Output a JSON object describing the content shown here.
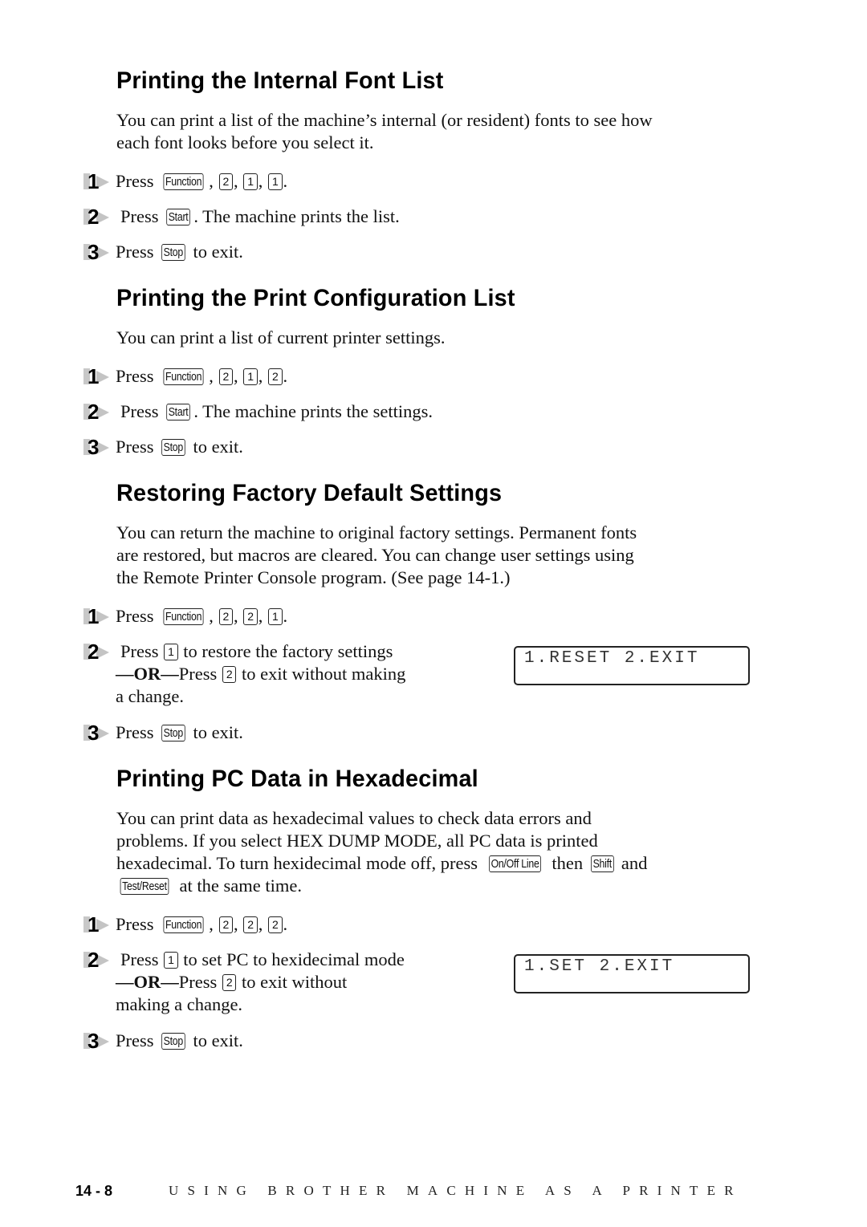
{
  "sections": [
    {
      "heading": "Printing the Internal Font List",
      "intro": [
        "You can print a list of the machine’s internal (or resident) fonts to see how",
        "each font looks before you select it."
      ],
      "steps": [
        {
          "num": "1",
          "before": "Press",
          "keys": [
            "Function",
            "2",
            "1",
            "1"
          ],
          "after": "."
        },
        {
          "num": "2",
          "before": "Press",
          "keys": [
            "Start"
          ],
          "after": ". The machine prints the list."
        },
        {
          "num": "3",
          "before": "Press",
          "keys": [
            "Stop"
          ],
          "after": " to exit."
        }
      ]
    },
    {
      "heading": "Printing the Print Configuration List",
      "intro": [
        "You can print a list of current printer settings."
      ],
      "steps": [
        {
          "num": "1",
          "before": "Press",
          "keys": [
            "Function",
            "2",
            "1",
            "2"
          ],
          "after": "."
        },
        {
          "num": "2",
          "before": "Press",
          "keys": [
            "Start"
          ],
          "after": ". The machine prints the settings."
        },
        {
          "num": "3",
          "before": "Press",
          "keys": [
            "Stop"
          ],
          "after": " to exit."
        }
      ]
    },
    {
      "heading": "Restoring Factory Default Settings",
      "intro": [
        "You can return the machine to original factory settings.  Permanent fonts",
        "are restored, but macros are cleared.  You can change user settings using",
        "the Remote Printer Console program. (See page 14-1.)"
      ],
      "steps": [
        {
          "num": "1",
          "before": "Press",
          "keys": [
            "Function",
            "2",
            "2",
            "1"
          ],
          "after": "."
        },
        {
          "num": "2",
          "line1_before": "Press",
          "key_a": "1",
          "line1_after": "to restore the factory settings",
          "or_label": "—OR—",
          "line2_before": "Press",
          "key_b": "2",
          "line2_after": "to exit without making",
          "line3": "a change."
        },
        {
          "num": "3",
          "before": "Press",
          "keys": [
            "Stop"
          ],
          "after": " to exit."
        }
      ],
      "lcd": "1.RESET 2.EXIT"
    },
    {
      "heading": "Printing PC Data in Hexadecimal",
      "intro_lines": {
        "l1": "You can print data as hexadecimal values to check data errors and",
        "l2": "problems. If you select HEX DUMP MODE, all PC data is printed",
        "l3_before": "hexadecimal. To turn hexidecimal mode off, press",
        "key_online": "On/Off Line",
        "l3_mid": "then",
        "key_shift": "Shift",
        "l3_after": "and",
        "key_testreset": "Test/Reset",
        "l4_after": "at the same time."
      },
      "steps": [
        {
          "num": "1",
          "before": "Press",
          "keys": [
            "Function",
            "2",
            "2",
            "2"
          ],
          "after": "."
        },
        {
          "num": "2",
          "line1_before": "Press",
          "key_a": "1",
          "line1_after": "to set PC to hexidecimal mode",
          "or_label": "—OR—",
          "line2_before": "Press",
          "key_b": "2",
          "line2_after": "to exit without",
          "line3": "making a change."
        },
        {
          "num": "3",
          "before": "Press",
          "keys": [
            "Stop"
          ],
          "after": " to exit."
        }
      ],
      "lcd": "1.SET 2.EXIT"
    }
  ],
  "footer": {
    "page_number": "14 - 8",
    "chapter_title": "USING BROTHER MACHINE AS A PRINTER"
  }
}
